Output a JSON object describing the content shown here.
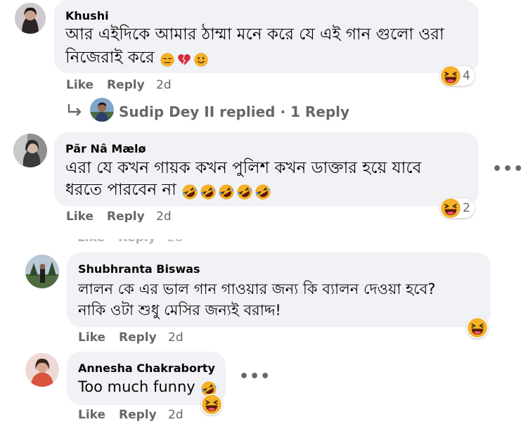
{
  "comments": [
    {
      "author": "Khushi",
      "text_line1": "আর এইদিকে আমার ঠাম্মা মনে করে যে এই গান গুলো ওরা",
      "text_line2": "নিজেরাই করে",
      "reaction_count": "4",
      "like": "Like",
      "reply": "Reply",
      "time": "2d"
    },
    {
      "author": "Pãr Nâ Mælø",
      "text_line1": "এরা যে কখন গায়ক কখন পুলিশ কখন ডাক্তার হয়ে যাবে",
      "text_line2": "ধরতে পারবেন না",
      "reaction_count": "2",
      "like": "Like",
      "reply": "Reply",
      "time": "2d"
    },
    {
      "author": "Shubhranta Biswas",
      "text_line1": "লালন কে এর ভাল গান গাওয়ার জন্য কি ব্যালন দেওয়া হবে?",
      "text_line2": "নাকি ওটা শুধু মেসির জন্যই বরাদ্দ!",
      "like": "Like",
      "reply": "Reply",
      "time": "2d"
    },
    {
      "author": "Annesha Chakraborty",
      "text_line1": "Too much funny",
      "like": "Like",
      "reply": "Reply",
      "time": "2d"
    }
  ],
  "reply_summary": {
    "author": "Sudip Dey II",
    "verb": "replied",
    "separator": "·",
    "count": "1 Reply"
  },
  "icons": {
    "reaction": "haha-icon",
    "rofl": "rolling-laughing-emoji",
    "expressionless": "expressionless-emoji",
    "broken_heart": "broken-heart-emoji",
    "smile": "slightly-smiling-emoji",
    "reply_arrow": "reply-arrow-icon",
    "more": "more-options-icon"
  },
  "colors": {
    "bubble": "#f0f2f5",
    "secondary_text": "#65676b",
    "primary_text": "#050505",
    "haha_yellow": "#f7b125"
  }
}
